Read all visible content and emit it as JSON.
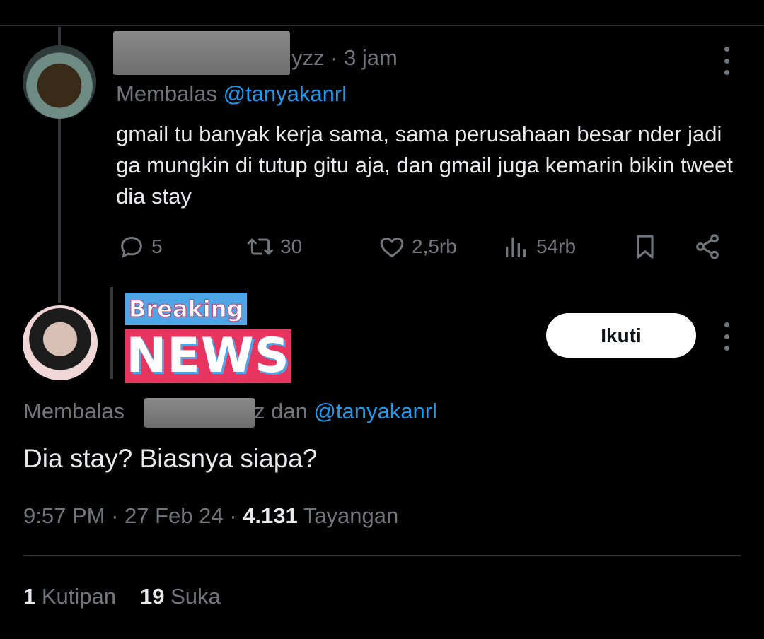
{
  "tweet1": {
    "handle_suffix": "yzz",
    "separator": " · ",
    "time": "3 jam",
    "replying_prefix": "Membalas ",
    "replying_to": "@tanyakanrl",
    "body": "gmail tu banyak kerja sama, sama perusahaan besar nder jadi ga mungkin di tutup gitu aja, dan gmail juga kemarin bikin tweet dia stay",
    "actions": {
      "replies": "5",
      "retweets": "30",
      "likes": "2,5rb",
      "views": "54rb"
    }
  },
  "tweet2": {
    "overlay": {
      "breaking": "Breaking",
      "news": "NEWS"
    },
    "follow_label": "Ikuti",
    "replying_prefix": "Membalas ",
    "replying_mid": "z dan ",
    "replying_to": "@tanyakanrl",
    "body": "Dia stay? Biasnya siapa?",
    "meta": {
      "time": "9:57 PM",
      "sep1": " · ",
      "date": "27 Feb 24",
      "sep2": " · ",
      "views": "4.131",
      "views_label": " Tayangan"
    },
    "stats": {
      "quotes": "1",
      "quotes_label": " Kutipan",
      "likes": "19",
      "likes_label": " Suka"
    }
  },
  "icons": [
    "reply-icon",
    "retweet-icon",
    "like-icon",
    "views-icon",
    "bookmark-icon",
    "share-icon",
    "more-icon"
  ],
  "colors": {
    "background": "#000000",
    "text": "#e7e9ea",
    "muted": "#71767b",
    "link": "#1d9bf0"
  }
}
